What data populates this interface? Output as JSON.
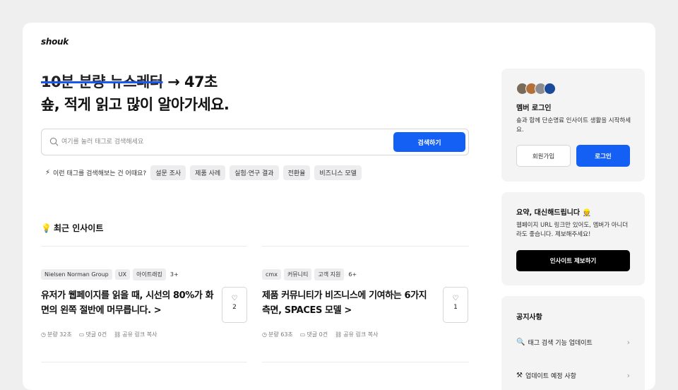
{
  "brand": {
    "logo": "shouk"
  },
  "hero": {
    "strike_text": "10분 분량 뉴스레터",
    "arrow": "→",
    "time_text": "47초",
    "line2": "숖, 적게 읽고 많이 알아가세요."
  },
  "search": {
    "icon": "search-icon",
    "placeholder": "여기를 눌러 태그로 검색해세요",
    "button_label": "검색하기"
  },
  "suggestions": {
    "icon": "lightning-icon",
    "prompt": "이런 태그를 검색해보는 건 어때요?",
    "tags": [
      "설문 조사",
      "제품 사례",
      "실험·연구 결과",
      "전환율",
      "비즈니스 모델"
    ]
  },
  "recent": {
    "icon": "lightbulb-icon",
    "emoji": "💡",
    "title": "최근 인사이트",
    "articles": [
      {
        "tags": [
          "Nielsen Norman Group",
          "UX",
          "아이트래킹"
        ],
        "more": "3+",
        "title": "유저가 웹페이지를 읽을 때, 시선의 80%가 화면의 왼쪽 절반에 머무릅니다.",
        "arrow": ">",
        "likes": "2",
        "read_time": "분량 32초",
        "comments": "댓글 0건",
        "share": "공유 링크 복사"
      },
      {
        "tags": [
          "cmx",
          "커뮤니티",
          "고객 지원"
        ],
        "more": "6+",
        "title": "제품 커뮤니티가 비즈니스에 기여하는 6가지 측면, SPACES 모델",
        "arrow": ">",
        "likes": "1",
        "read_time": "분량 63초",
        "comments": "댓글 0건",
        "share": "공유 링크 복사"
      }
    ]
  },
  "login_panel": {
    "avatars": [
      "#7a6a5a",
      "#b5703a",
      "#8c8c90",
      "#1b4a9c"
    ],
    "title": "멤버 로그인",
    "desc": "숖과 함께 단순명료 인사이트 생활을 시작하세요.",
    "signup_label": "회원가입",
    "login_label": "로그인"
  },
  "summary_panel": {
    "title": "요약, 대신해드립니다 👷",
    "desc": "웹페이지 URL 링크만 있어도, 멤버가 아니더라도 좋습니다. 제보해주세요!",
    "button_label": "인사이트 제보하기"
  },
  "notice_panel": {
    "title": "공지사항",
    "items": [
      {
        "icon": "magnifier-icon",
        "emoji": "🔍",
        "label": "태그 검색 기능 업데이트"
      },
      {
        "icon": "hammer-pick-icon",
        "emoji": "⚒",
        "label": "업데이트 예정 사항"
      }
    ]
  },
  "icons": {
    "heart": "heart-icon",
    "clock": "clock-icon",
    "comment": "comment-icon",
    "link": "link-icon",
    "chevron": "chevron-right-icon"
  },
  "colors": {
    "accent": "#1460f5",
    "page_bg": "#efeff0",
    "panel_bg": "#f4f4f5"
  }
}
